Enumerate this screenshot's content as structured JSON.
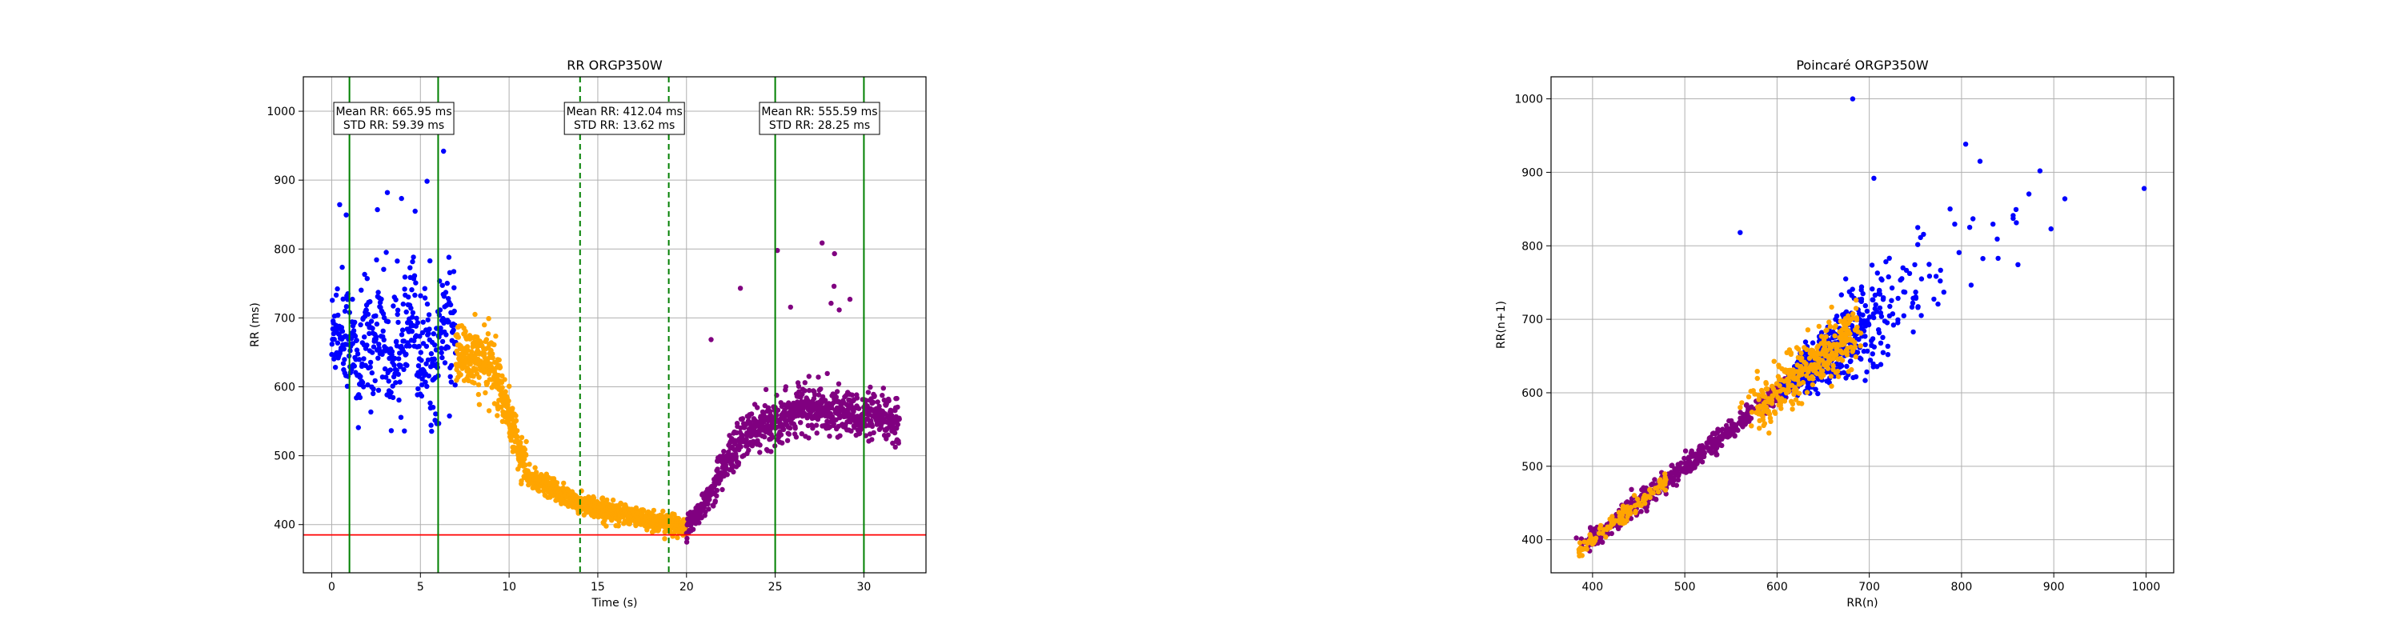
{
  "chart_data": [
    {
      "type": "scatter",
      "title": "RR ORGP350W",
      "xlabel": "Time (s)",
      "ylabel": "RR (ms)",
      "xlim": [
        -1.6,
        33.5
      ],
      "ylim": [
        330,
        1050
      ],
      "xticks": [
        0,
        5,
        10,
        15,
        20,
        25,
        30
      ],
      "yticks": [
        400,
        500,
        600,
        700,
        800,
        900,
        1000
      ],
      "grid": true,
      "series_colors": [
        "#0000ff",
        "#ffa500",
        "#800080"
      ],
      "phases": [
        {
          "color": "#0000ff",
          "t_start": 0,
          "t_end": 7,
          "approx_mean": 666,
          "approx_spread": 50
        },
        {
          "color": "#ffa500",
          "t_start": 7,
          "t_end": 20,
          "level_start": 650,
          "level_end": 395
        },
        {
          "color": "#800080",
          "t_start": 20,
          "t_end": 32,
          "level_start": 395,
          "level_end": 555
        }
      ],
      "hlines": [
        {
          "y": 385,
          "color": "#ff0000"
        }
      ],
      "vlines": [
        {
          "x": 1,
          "color": "#008000",
          "style": "solid"
        },
        {
          "x": 6,
          "color": "#008000",
          "style": "solid"
        },
        {
          "x": 14,
          "color": "#008000",
          "style": "dashed"
        },
        {
          "x": 19,
          "color": "#008000",
          "style": "dashed"
        },
        {
          "x": 25,
          "color": "#008000",
          "style": "solid"
        },
        {
          "x": 30,
          "color": "#008000",
          "style": "solid"
        }
      ],
      "annotations": [
        {
          "x_center": 3.5,
          "line1": "Mean RR: 665.95 ms",
          "line2": "STD RR: 59.39 ms"
        },
        {
          "x_center": 16.5,
          "line1": "Mean RR: 412.04 ms",
          "line2": "STD RR: 13.62 ms"
        },
        {
          "x_center": 27.5,
          "line1": "Mean RR: 555.59 ms",
          "line2": "STD RR: 28.25 ms"
        }
      ]
    },
    {
      "type": "scatter",
      "title": "Poincaré ORGP350W",
      "xlabel": "RR(n)",
      "ylabel": "RR(n+1)",
      "xlim": [
        355,
        1030
      ],
      "ylim": [
        355,
        1030
      ],
      "xticks": [
        400,
        500,
        600,
        700,
        800,
        900,
        1000
      ],
      "yticks": [
        400,
        500,
        600,
        700,
        800,
        900,
        1000
      ],
      "grid": true,
      "series_colors": [
        "#0000ff",
        "#ffa500",
        "#800080"
      ],
      "outliers": [
        {
          "x": 682,
          "y": 1000
        },
        {
          "x": 998,
          "y": 878
        },
        {
          "x": 820,
          "y": 915
        },
        {
          "x": 885,
          "y": 902
        },
        {
          "x": 912,
          "y": 864
        },
        {
          "x": 897,
          "y": 823
        },
        {
          "x": 705,
          "y": 892
        },
        {
          "x": 560,
          "y": 818
        }
      ]
    }
  ]
}
